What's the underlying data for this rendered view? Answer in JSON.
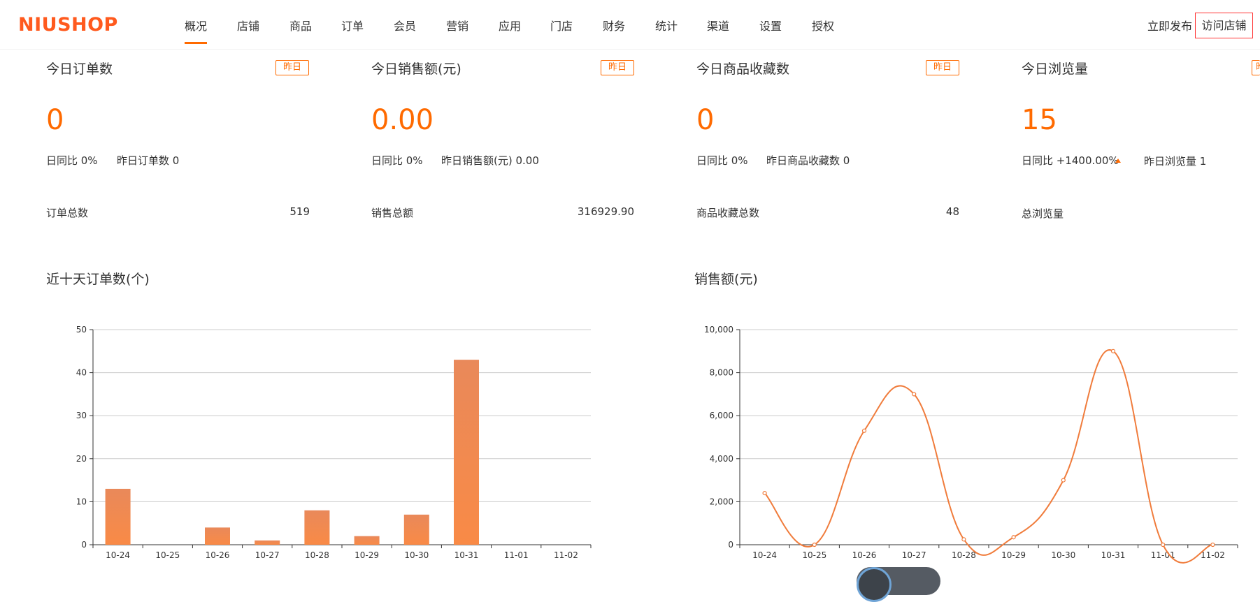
{
  "header": {
    "logo": "NIUSHOP",
    "nav": [
      {
        "label": "概况",
        "active": true
      },
      {
        "label": "店铺"
      },
      {
        "label": "商品"
      },
      {
        "label": "订单"
      },
      {
        "label": "会员"
      },
      {
        "label": "营销"
      },
      {
        "label": "应用"
      },
      {
        "label": "门店"
      },
      {
        "label": "财务"
      },
      {
        "label": "统计"
      },
      {
        "label": "渠道"
      },
      {
        "label": "设置"
      },
      {
        "label": "授权"
      }
    ],
    "publish_label": "立即发布",
    "visit_label": "访问店铺"
  },
  "cards": [
    {
      "title": "今日订单数",
      "yesterday_btn": "昨日",
      "value": "0",
      "ratio": "日同比 0%",
      "yesterday_text": "昨日订单数 0",
      "total_label": "订单总数",
      "total_value": "519"
    },
    {
      "title": "今日销售额(元)",
      "yesterday_btn": "昨日",
      "value": "0.00",
      "ratio": "日同比 0%",
      "yesterday_text": "昨日销售额(元) 0.00",
      "total_label": "销售总额",
      "total_value": "316929.90"
    },
    {
      "title": "今日商品收藏数",
      "yesterday_btn": "昨日",
      "value": "0",
      "ratio": "日同比 0%",
      "yesterday_text": "昨日商品收藏数 0",
      "total_label": "商品收藏总数",
      "total_value": "48"
    },
    {
      "title": "今日浏览量",
      "yesterday_btn": "昨",
      "value": "15",
      "ratio": "日同比 +1400.00%",
      "yesterday_text": "昨日浏览量 1",
      "total_label": "总浏览量",
      "total_value": ""
    }
  ],
  "colors": {
    "accent": "#ff6a00",
    "bar": "#f08a4b",
    "line": "#f07c3c",
    "grid": "#cccccc"
  },
  "chart_data": [
    {
      "type": "bar",
      "title": "近十天订单数(个)",
      "categories": [
        "10-24",
        "10-25",
        "10-26",
        "10-27",
        "10-28",
        "10-29",
        "10-30",
        "10-31",
        "11-01",
        "11-02"
      ],
      "values": [
        13,
        0,
        4,
        1,
        8,
        2,
        7,
        43,
        0,
        0
      ],
      "ylim": [
        0,
        50
      ],
      "yticks": [
        0,
        10,
        20,
        30,
        40,
        50
      ],
      "grid": true
    },
    {
      "type": "line",
      "title": "销售额(元)",
      "categories": [
        "10-24",
        "10-25",
        "10-26",
        "10-27",
        "10-28",
        "10-29",
        "10-30",
        "10-31",
        "11-01",
        "11-02"
      ],
      "values": [
        2400,
        0,
        5300,
        7000,
        250,
        350,
        3000,
        9000,
        0,
        0
      ],
      "ylim": [
        0,
        10000
      ],
      "yticks": [
        "0",
        "2,000",
        "4,000",
        "6,000",
        "8,000",
        "10,000"
      ],
      "grid": true,
      "smooth": true
    }
  ]
}
